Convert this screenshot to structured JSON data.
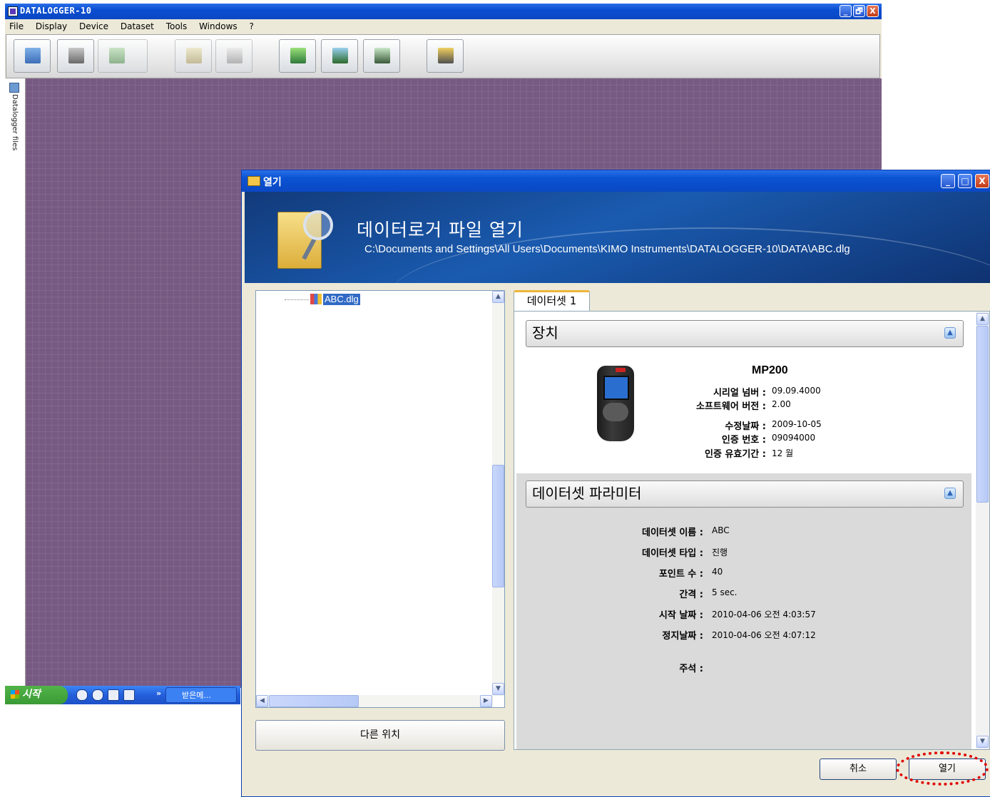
{
  "app": {
    "title": "DATALOGGER-10",
    "menu": [
      "File",
      "Display",
      "Device",
      "Dataset",
      "Tools",
      "Windows",
      "?"
    ],
    "caption_buttons": [
      "_",
      "🗗",
      "X"
    ],
    "side_panel_label": "Datalogger files",
    "toolbar_icons": [
      "new-icon",
      "save-icon",
      "settings-icon",
      "preview-icon",
      "print-icon",
      "download-icon",
      "upload-icon",
      "device-icon",
      "tools-icon"
    ]
  },
  "taskbar": {
    "start_label": "시작",
    "task_label": "받은메..."
  },
  "dialog": {
    "title": "열기",
    "heading": "데이터로거 파일 열기",
    "path": "C:\\Documents and Settings\\All Users\\Documents\\KIMO Instruments\\DATALOGGER-10\\DATA\\ABC.dlg",
    "tree_item": "ABC.dlg",
    "other_location_button": "다른 위치",
    "tab_label": "데이터셋 1",
    "device_section": {
      "heading": "장치",
      "model": "MP200",
      "fields": [
        {
          "label": "시리얼 넘버 :",
          "value": "09.09.4000"
        },
        {
          "label": "소프트웨어 버전 :",
          "value": "2.00"
        },
        {
          "label": "수정날짜 :",
          "value": "2009-10-05"
        },
        {
          "label": "인증 번호 :",
          "value": "09094000"
        },
        {
          "label": "인증 유효기간 :",
          "value": "12 월"
        }
      ]
    },
    "dataset_section": {
      "heading": "데이터셋 파라미터",
      "fields": [
        {
          "label": "데이터셋 이름 :",
          "value": "ABC"
        },
        {
          "label": "데이터셋 타입 :",
          "value": "진행"
        },
        {
          "label": "포인트 수 :",
          "value": "40"
        },
        {
          "label": "간격 :",
          "value": "5 sec."
        },
        {
          "label": "시작 날짜 :",
          "value": "2010-04-06 오전 4:03:57"
        },
        {
          "label": "정지날짜 :",
          "value": "2010-04-06 오전 4:07:12"
        },
        {
          "label": "주석 :",
          "value": ""
        }
      ]
    },
    "cancel_button": "취소",
    "open_button": "열기"
  }
}
